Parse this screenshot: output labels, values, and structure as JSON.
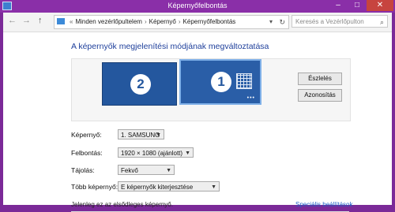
{
  "window": {
    "title": "Képernyőfelbontás",
    "min_label": "–",
    "max_label": "□",
    "close_label": "✕"
  },
  "nav": {
    "back_label": "←",
    "forward_label": "→",
    "up_label": "↑",
    "breadcrumb": [
      "Minden vezérlőpultelem",
      "Képernyő",
      "Képernyőfelbontás"
    ],
    "search_placeholder": "Keresés a Vezérlőpulton"
  },
  "main": {
    "heading": "A képernyők megjelenítési módjának megváltoztatása",
    "monitors": [
      {
        "number": "2"
      },
      {
        "number": "1"
      }
    ],
    "detect_button": "Észlelés",
    "identify_button": "Azonosítás",
    "fields": {
      "display_label": "Képernyő:",
      "display_value": "1. SAMSUNG",
      "resolution_label": "Felbontás:",
      "resolution_value": "1920 × 1080 (ajánlott)",
      "orientation_label": "Tájolás:",
      "orientation_value": "Fekvő",
      "multiple_label": "Több képernyő:",
      "multiple_value": "E képernyők kiterjesztése"
    },
    "primary_note": "Jelenleg ez az elsődleges képernyő.",
    "advanced_link": "Speciális beállítások"
  },
  "colors": {
    "titlebar": "#8a2fa8",
    "heading": "#1e3f9b",
    "monitor": "#24579e",
    "link": "#1d5fc6"
  }
}
